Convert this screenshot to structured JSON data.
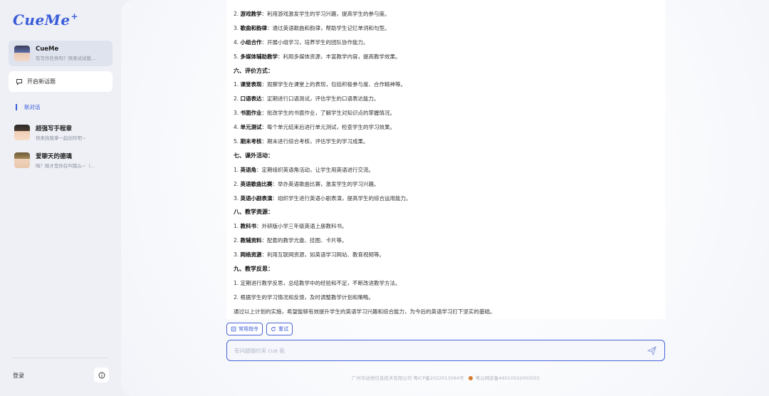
{
  "sidebar": {
    "logo": "CueMe",
    "logo_plus": "+",
    "active_chat": {
      "title": "CueMe",
      "subtitle": "有写作任务吗？快来试试我..."
    },
    "new_topic_label": "开启新话题",
    "new_chat_label": "新对话",
    "chats": [
      {
        "title": "超强写手程章",
        "subtitle": "快来找我拿一起创作吧~"
      },
      {
        "title": "爱聊天的德璃",
        "subtitle": "嗔？刚才是你在叫我么~（..."
      }
    ],
    "login_label": "登录"
  },
  "content": {
    "lines": [
      {
        "kind": "item",
        "num": "2.",
        "bold": "游戏教学",
        "text": "：利用游戏激发学生的学习兴趣，提高学生的参与度。"
      },
      {
        "kind": "item",
        "num": "3.",
        "bold": "歌曲和韵律",
        "text": "：通过英语歌曲和韵律，帮助学生记忆单词和句型。"
      },
      {
        "kind": "item",
        "num": "4.",
        "bold": "小组合作",
        "text": "：开展小组学习，培养学生的团队协作能力。"
      },
      {
        "kind": "item",
        "num": "5.",
        "bold": "多媒体辅助教学",
        "text": "：利用多媒体资源，丰富教学内容，提高教学效果。"
      },
      {
        "kind": "heading",
        "text": "六、评价方式："
      },
      {
        "kind": "item",
        "num": "1.",
        "bold": "课堂表现",
        "text": "：观察学生在课堂上的表现，包括积极参与度、合作精神等。"
      },
      {
        "kind": "item",
        "num": "2.",
        "bold": "口语表达",
        "text": "：定期进行口语测试，评估学生的口语表达能力。"
      },
      {
        "kind": "item",
        "num": "3.",
        "bold": "书面作业",
        "text": "：批改学生的书面作业，了解学生对知识点的掌握情况。"
      },
      {
        "kind": "item",
        "num": "4.",
        "bold": "单元测试",
        "text": "：每个单元结束后进行单元测试，检查学生的学习效果。"
      },
      {
        "kind": "item",
        "num": "5.",
        "bold": "期末考核",
        "text": "：期末进行综合考核，评估学生的学习成果。"
      },
      {
        "kind": "heading",
        "text": "七、课外活动："
      },
      {
        "kind": "item",
        "num": "1.",
        "bold": "英语角",
        "text": "：定期组织英语角活动，让学生用英语进行交流。"
      },
      {
        "kind": "item",
        "num": "2.",
        "bold": "英语歌曲比赛",
        "text": "：举办英语歌曲比赛，激发学生的学习兴趣。"
      },
      {
        "kind": "item",
        "num": "3.",
        "bold": "英语小剧表演",
        "text": "：组织学生进行英语小剧表演，提高学生的综合运用能力。"
      },
      {
        "kind": "heading",
        "text": "八、教学资源："
      },
      {
        "kind": "item",
        "num": "1.",
        "bold": "教科书",
        "text": "：外研版小学三年级英语上册教科书。"
      },
      {
        "kind": "item",
        "num": "2.",
        "bold": "教辅资料",
        "text": "：配套的教学光盘、挂图、卡片等。"
      },
      {
        "kind": "item",
        "num": "3.",
        "bold": "网络资源",
        "text": "：利用互联网资源，如英语学习网站、教育视频等。"
      },
      {
        "kind": "heading",
        "text": "九、教学反思："
      },
      {
        "kind": "item",
        "num": "1.",
        "bold": "",
        "text": "定期进行教学反思，总结教学中的经验和不足，不断改进教学方法。"
      },
      {
        "kind": "item",
        "num": "2.",
        "bold": "",
        "text": "根据学生的学习情况和反馈，及时调整教学计划和策略。"
      },
      {
        "kind": "plain",
        "text": "通过以上计划的实施，希望能够有效提升学生的英语学习兴趣和综合能力，为今后的英语学习打下坚实的基础。"
      }
    ]
  },
  "chips": {
    "common_commands": "常用指令",
    "retry": "重试"
  },
  "input": {
    "placeholder": "有问题随时来 cue 我"
  },
  "footer": {
    "company": "广州市动悦信息技术有限公司 粤ICP备2022013084号",
    "police": "粤公网安备44010502003055"
  },
  "colors": {
    "accent": "#3a5bd9",
    "sidebar_bg": "#eef0f6"
  }
}
